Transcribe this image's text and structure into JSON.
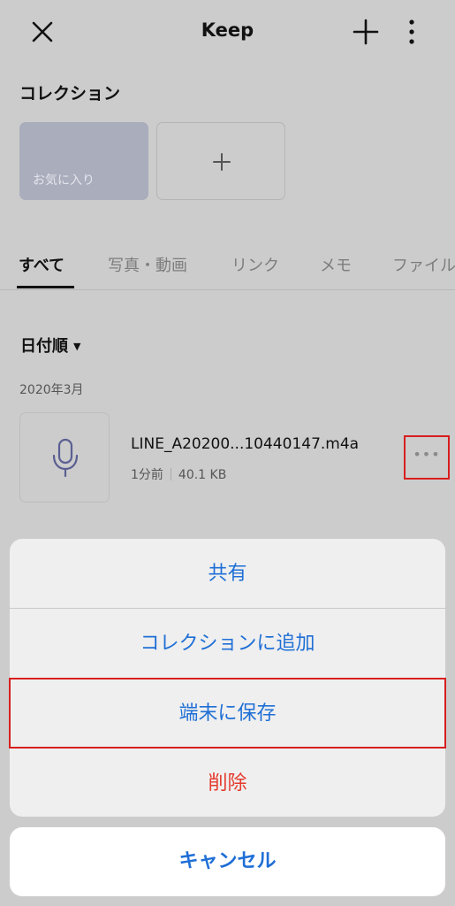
{
  "header": {
    "title": "Keep",
    "icons": {
      "close": "close-icon",
      "add": "plus-icon",
      "more": "more-vertical-icon"
    }
  },
  "collection": {
    "heading": "コレクション",
    "items": [
      {
        "label": "お気に入り"
      }
    ],
    "add_icon": "plus-icon"
  },
  "tabs": [
    {
      "label": "すべて",
      "active": true
    },
    {
      "label": "写真・動画"
    },
    {
      "label": "リンク"
    },
    {
      "label": "メモ"
    },
    {
      "label": "ファイル"
    }
  ],
  "list": {
    "sort_label": "日付順",
    "sort_icon": "caret-down-icon",
    "month": "2020年3月",
    "items": [
      {
        "icon": "microphone-icon",
        "name": "LINE_A20200...10440147.m4a",
        "time": "1分前",
        "size": "40.1 KB",
        "more_icon": "more-horizontal-icon"
      }
    ]
  },
  "action_sheet": {
    "items": [
      {
        "label": "共有"
      },
      {
        "label": "コレクションに追加"
      },
      {
        "label": "端末に保存"
      },
      {
        "label": "削除"
      }
    ],
    "cancel_label": "キャンセル"
  },
  "colors": {
    "accent": "#1f6fd6",
    "destructive": "#e53a2e",
    "highlight": "#d81e1e"
  }
}
